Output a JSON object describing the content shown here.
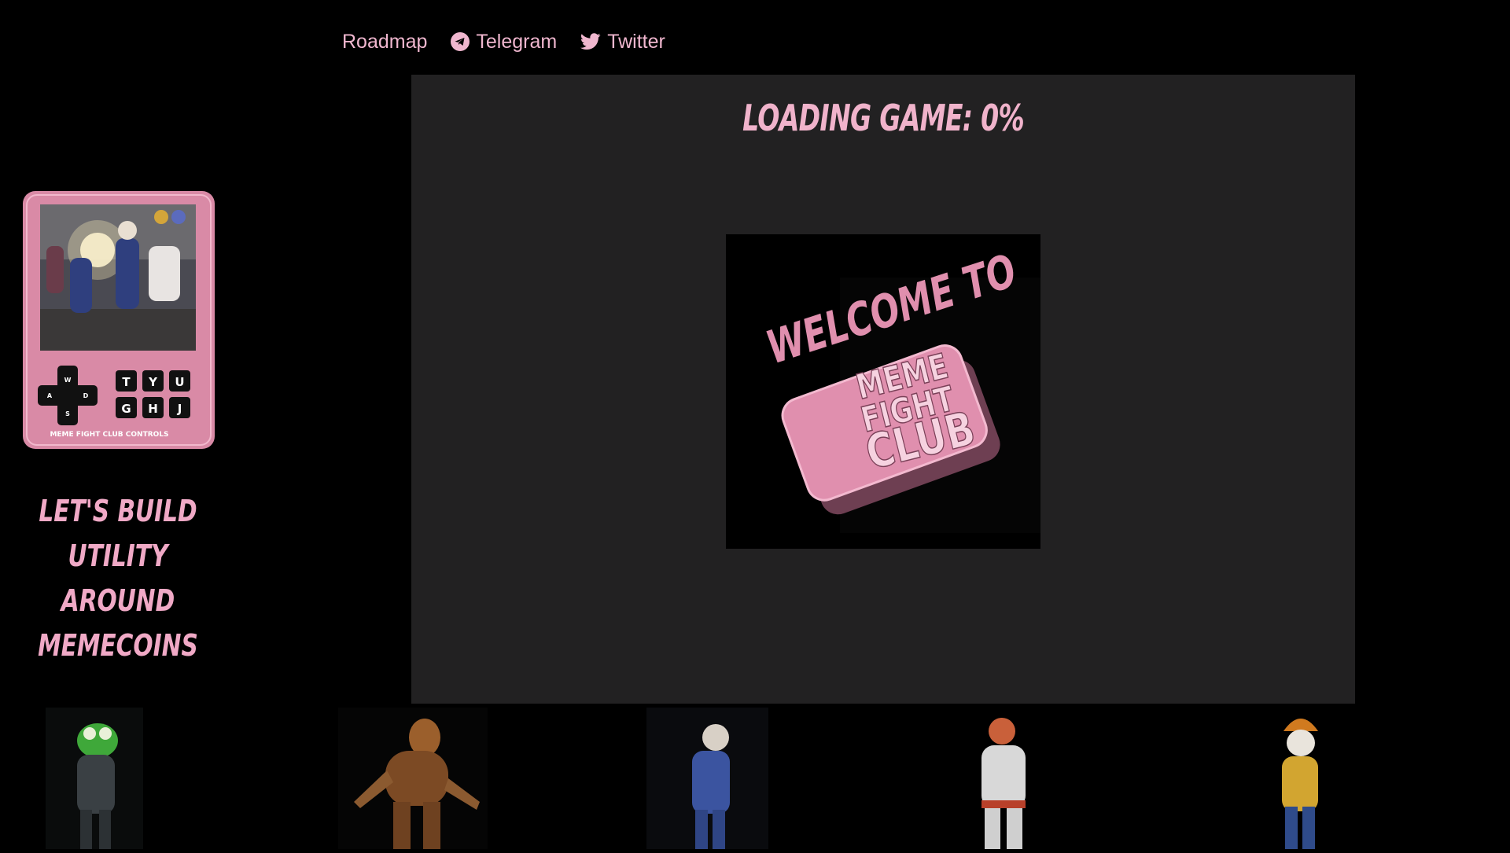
{
  "nav": {
    "items": [
      {
        "label": "Roadmap",
        "icon": ""
      },
      {
        "label": "Telegram",
        "icon": "telegram-icon"
      },
      {
        "label": "Twitter",
        "icon": "twitter-icon"
      }
    ]
  },
  "game": {
    "loading_text": "LOADING GAME: 0%",
    "splash": {
      "line1": "WELCOME TO",
      "logo_line1": "MEME",
      "logo_line2": "FIGHT",
      "logo_line3": "CLUB"
    }
  },
  "controls": {
    "keys_row1": [
      "T",
      "Y",
      "U"
    ],
    "keys_row2": [
      "G",
      "H",
      "J"
    ],
    "dpad": {
      "up": "W",
      "left": "A",
      "right": "D",
      "down": "S"
    },
    "caption": "MEME FIGHT CLUB CONTROLS"
  },
  "tagline": {
    "line1": "LET'S BUILD UTILITY",
    "line2": "AROUND MEMECOINS"
  },
  "characters": [
    "frog-fighter",
    "dog-fighter",
    "bald-suit-fighter",
    "karate-fighter",
    "hat-dog-fighter"
  ],
  "colors": {
    "background": "#000000",
    "panel": "#222122",
    "accent_pink": "#f0b3cb",
    "card_pink": "#d98aa6",
    "logo_pink": "#e08fae"
  }
}
